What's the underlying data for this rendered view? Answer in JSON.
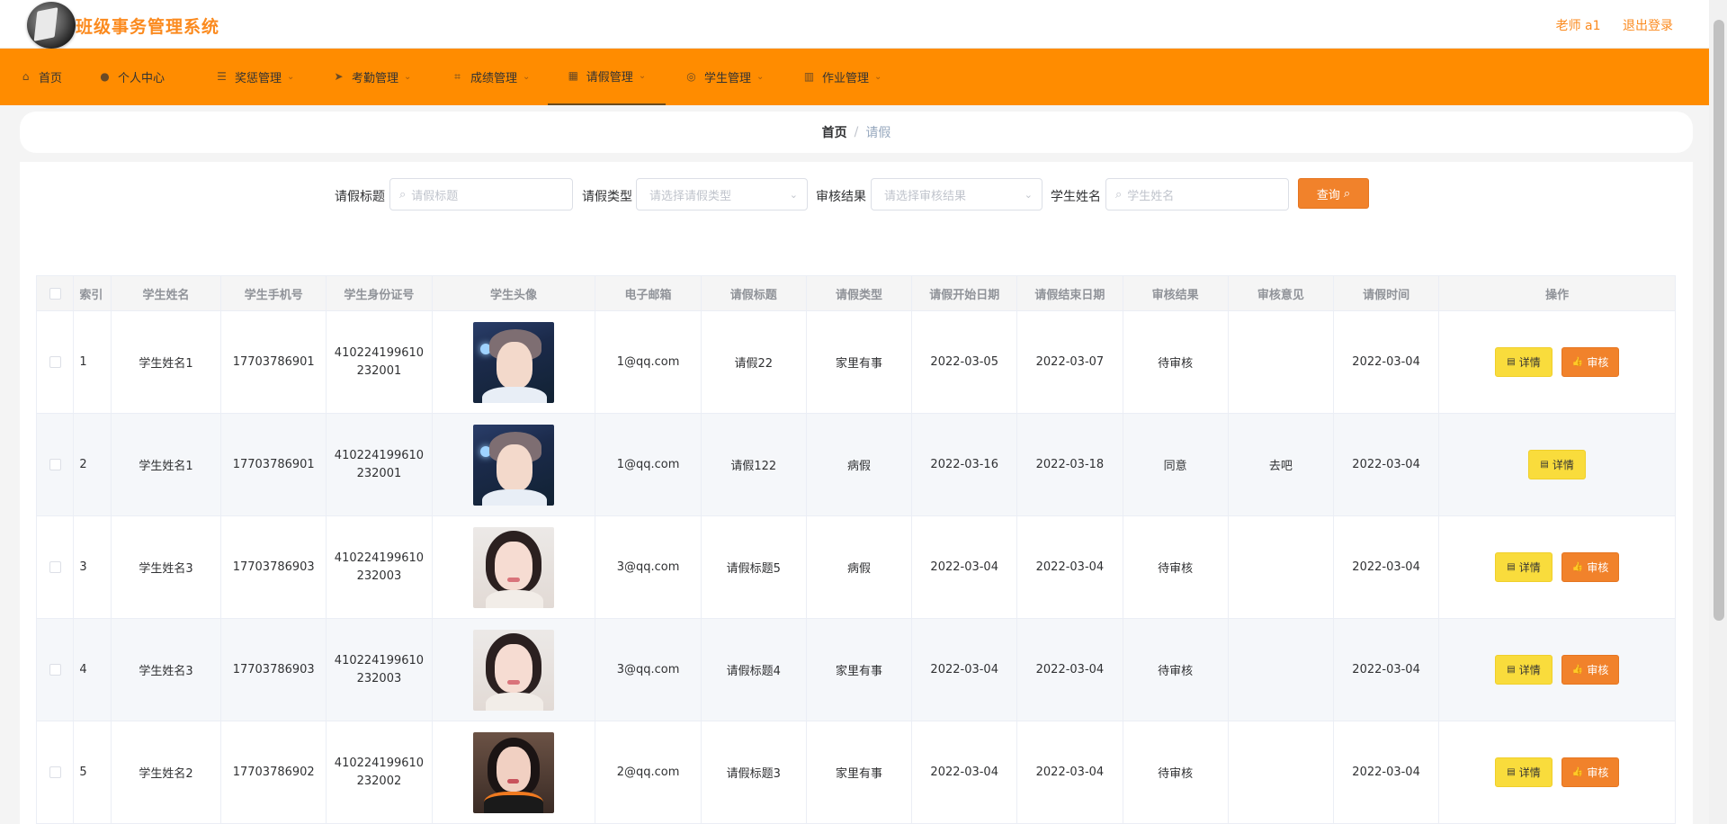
{
  "header": {
    "app_title": "班级事务管理系统",
    "user_label": "老师 a1",
    "logout_label": "退出登录"
  },
  "nav": {
    "items": [
      {
        "label": "首页",
        "icon": "home-icon"
      },
      {
        "label": "个人中心",
        "icon": "user-icon"
      },
      {
        "label": "奖惩管理",
        "icon": "list-icon"
      },
      {
        "label": "考勤管理",
        "icon": "send-icon"
      },
      {
        "label": "成绩管理",
        "icon": "crop-icon"
      },
      {
        "label": "请假管理",
        "icon": "grid-icon"
      },
      {
        "label": "学生管理",
        "icon": "circle-icon"
      },
      {
        "label": "作业管理",
        "icon": "building-icon"
      }
    ],
    "active_index": 5
  },
  "breadcrumb": {
    "home": "首页",
    "separator": "/",
    "current": "请假"
  },
  "search": {
    "title_label": "请假标题",
    "title_placeholder": "请假标题",
    "type_label": "请假类型",
    "type_placeholder": "请选择请假类型",
    "result_label": "审核结果",
    "result_placeholder": "请选择审核结果",
    "name_label": "学生姓名",
    "name_placeholder": "学生姓名",
    "query_label": "查询"
  },
  "table": {
    "headers": [
      "索引",
      "学生姓名",
      "学生手机号",
      "学生身份证号",
      "学生头像",
      "电子邮箱",
      "请假标题",
      "请假类型",
      "请假开始日期",
      "请假结束日期",
      "审核结果",
      "审核意见",
      "请假时间",
      "操作"
    ],
    "detail_label": "详情",
    "audit_label": "审核",
    "rows": [
      {
        "index": "1",
        "name": "学生姓名1",
        "phone": "17703786901",
        "id_card": "410224199610232001",
        "avatar": "boy",
        "email": "1@qq.com",
        "title": "请假22",
        "type": "家里有事",
        "start": "2022-03-05",
        "end": "2022-03-07",
        "result": "待审核",
        "opinion": "",
        "time": "2022-03-04",
        "can_audit": true
      },
      {
        "index": "2",
        "name": "学生姓名1",
        "phone": "17703786901",
        "id_card": "410224199610232001",
        "avatar": "boy",
        "email": "1@qq.com",
        "title": "请假122",
        "type": "病假",
        "start": "2022-03-16",
        "end": "2022-03-18",
        "result": "同意",
        "opinion": "去吧",
        "time": "2022-03-04",
        "can_audit": false
      },
      {
        "index": "3",
        "name": "学生姓名3",
        "phone": "17703786903",
        "id_card": "410224199610232003",
        "avatar": "girl",
        "email": "3@qq.com",
        "title": "请假标题5",
        "type": "病假",
        "start": "2022-03-04",
        "end": "2022-03-04",
        "result": "待审核",
        "opinion": "",
        "time": "2022-03-04",
        "can_audit": true
      },
      {
        "index": "4",
        "name": "学生姓名3",
        "phone": "17703786903",
        "id_card": "410224199610232003",
        "avatar": "girl",
        "email": "3@qq.com",
        "title": "请假标题4",
        "type": "家里有事",
        "start": "2022-03-04",
        "end": "2022-03-04",
        "result": "待审核",
        "opinion": "",
        "time": "2022-03-04",
        "can_audit": true
      },
      {
        "index": "5",
        "name": "学生姓名2",
        "phone": "17703786902",
        "id_card": "410224199610232002",
        "avatar": "dark",
        "email": "2@qq.com",
        "title": "请假标题3",
        "type": "家里有事",
        "start": "2022-03-04",
        "end": "2022-03-04",
        "result": "待审核",
        "opinion": "",
        "time": "2022-03-04",
        "can_audit": true
      }
    ]
  },
  "colors": {
    "accent": "#ff8c00",
    "title": "#fb8a1e",
    "detail_button": "#f9dc3c",
    "audit_button": "#f1822b"
  }
}
